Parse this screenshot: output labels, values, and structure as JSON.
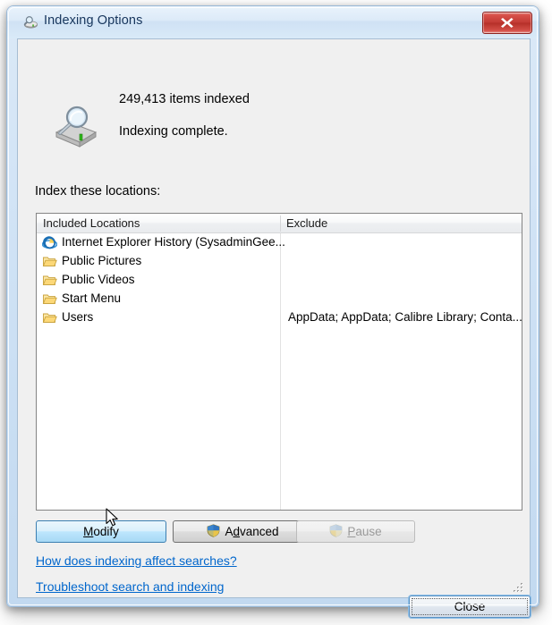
{
  "window": {
    "title": "Indexing Options",
    "icon": "indexing-options-icon",
    "close_button_icon": "close-x-icon",
    "accent_color": "#cfe2f5",
    "frame_border_color": "#9bb9d6",
    "close_button_color": "#c23a34"
  },
  "status": {
    "icon": "drive-magnifier-icon",
    "items_indexed": "249,413 items indexed",
    "indexing_state": "Indexing complete."
  },
  "locations": {
    "section_label": "Index these locations:",
    "columns": {
      "included": "Included Locations",
      "exclude": "Exclude"
    },
    "rows": [
      {
        "icon": "internet-explorer-icon",
        "label": "Internet Explorer History (SysadminGee...",
        "exclude": ""
      },
      {
        "icon": "folder-icon",
        "label": "Public Pictures",
        "exclude": ""
      },
      {
        "icon": "folder-icon",
        "label": "Public Videos",
        "exclude": ""
      },
      {
        "icon": "folder-icon",
        "label": "Start Menu",
        "exclude": ""
      },
      {
        "icon": "folder-icon",
        "label": "Users",
        "exclude": "AppData; AppData; Calibre Library; Conta..."
      }
    ]
  },
  "buttons": {
    "modify": {
      "label_prefix": "",
      "accel": "M",
      "label_suffix": "odify",
      "state": "hovered"
    },
    "advanced": {
      "label_prefix": "A",
      "accel": "d",
      "label_suffix": "vanced",
      "icon": "uac-shield-icon",
      "state": "enabled"
    },
    "pause": {
      "label_prefix": "",
      "accel": "P",
      "label_suffix": "ause",
      "icon": "uac-shield-icon-disabled",
      "state": "disabled"
    },
    "close": {
      "label": "Close",
      "state": "focused"
    }
  },
  "links": {
    "how_does_indexing": "How does indexing affect searches?",
    "troubleshoot": "Troubleshoot search and indexing",
    "link_color": "#0066cc"
  },
  "chrome": {
    "resize_grip_icon": "resize-grip-icon",
    "cursor_icon": "arrow-cursor-icon"
  }
}
